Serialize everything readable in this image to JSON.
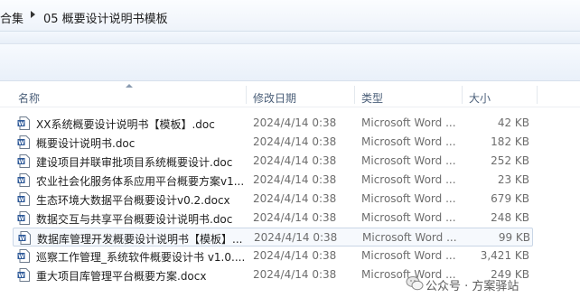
{
  "breadcrumb": {
    "root": "合集",
    "current": "05 概要设计说明书模板"
  },
  "columns": {
    "name": "名称",
    "date": "修改日期",
    "type": "类型",
    "size": "大小"
  },
  "files": [
    {
      "name": "XX系统概要设计说明书【模板】.doc",
      "date": "2024/4/14 0:38",
      "type": "Microsoft Word ...",
      "size": "42 KB"
    },
    {
      "name": "概要设计说明书.doc",
      "date": "2024/4/14 0:38",
      "type": "Microsoft Word ...",
      "size": "182 KB"
    },
    {
      "name": "建设项目并联审批项目系统概要设计.doc",
      "date": "2024/4/14 0:38",
      "type": "Microsoft Word ...",
      "size": "252 KB"
    },
    {
      "name": "农业社会化服务体系应用平台概要方案v1...",
      "date": "2024/4/14 0:38",
      "type": "Microsoft Word ...",
      "size": "23 KB"
    },
    {
      "name": "生态环境大数据平台概要设计v0.2.docx",
      "date": "2024/4/14 0:38",
      "type": "Microsoft Word ...",
      "size": "679 KB"
    },
    {
      "name": "数据交互与共享平台概要设计说明书.doc",
      "date": "2024/4/14 0:38",
      "type": "Microsoft Word ...",
      "size": "248 KB"
    },
    {
      "name": "数据库管理开发概要设计说明书【模板】...",
      "date": "2024/4/14 0:38",
      "type": "Microsoft Word ...",
      "size": "99 KB"
    },
    {
      "name": "巡察工作管理_系统软件概要设计书 v1.0....",
      "date": "2024/4/14 0:38",
      "type": "Microsoft Word ...",
      "size": "3,421 KB"
    },
    {
      "name": "重大项目库管理平台概要方案.docx",
      "date": "2024/4/14 0:38",
      "type": "Microsoft Word ...",
      "size": "249 KB"
    }
  ],
  "watermark": {
    "text": "公众号 · 方案驿站"
  },
  "colors": {
    "word_blue": "#2b5797",
    "selection_border": "#c9d6e6",
    "header_text": "#4c607a"
  },
  "icons": {
    "file": "word-doc-icon",
    "breadcrumb_separator": "chevron-right-icon",
    "sort": "sort-ascending-icon",
    "watermark": "wechat-icon"
  }
}
